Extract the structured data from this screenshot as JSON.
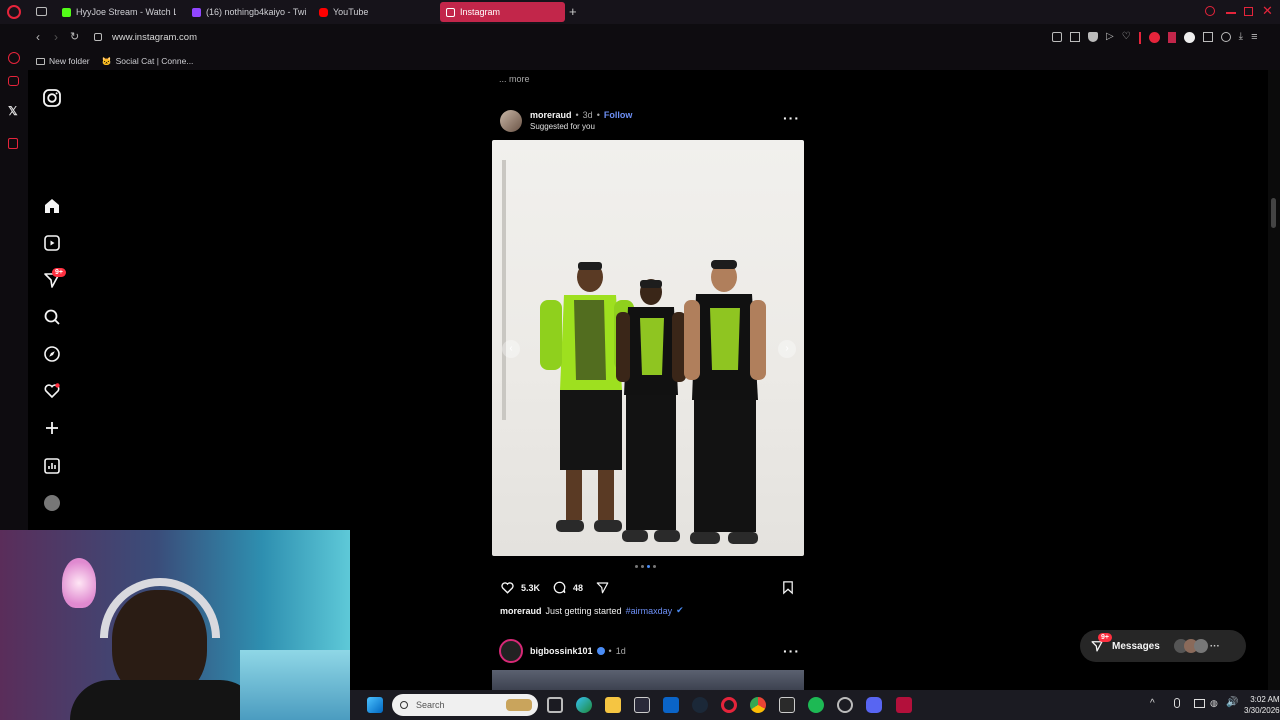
{
  "browser": {
    "tabs": [
      {
        "label": "HyyJoe Stream - Watch Li",
        "color": "#53fc18"
      },
      {
        "label": "(16) nothingb4kaiyo - Twi",
        "color": "#9146ff"
      },
      {
        "label": "YouTube",
        "color": "#ff0000"
      },
      {
        "label": "Instagram",
        "color": "#e1306c"
      }
    ],
    "url": "www.instagram.com",
    "bookmarks": [
      "New folder",
      "Social Cat | Conne..."
    ]
  },
  "instagram": {
    "prev_caption_more": "... more",
    "post1": {
      "username": "moreraud",
      "time": "3d",
      "follow_label": "Follow",
      "suggested": "Suggested for you",
      "likes": "5.3K",
      "comments": "48",
      "caption_user": "moreraud",
      "caption_text": "Just getting started",
      "caption_tag": "#airmaxday"
    },
    "post2": {
      "username": "bigbossink101",
      "time": "1d"
    },
    "nav_badge": "9+",
    "messages_label": "Messages",
    "messages_badge": "9+"
  },
  "taskbar": {
    "search_placeholder": "Search",
    "time": "3:02 AM",
    "date": "3/30/2026"
  }
}
